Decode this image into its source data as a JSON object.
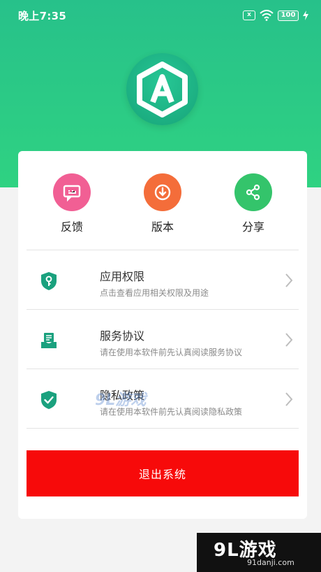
{
  "status_bar": {
    "time": "晚上7:35",
    "sim": "x",
    "battery": "100"
  },
  "quick_actions": [
    {
      "label": "反馈",
      "color": "#f15f94",
      "icon": "feedback-icon"
    },
    {
      "label": "版本",
      "color": "#f46d3a",
      "icon": "download-icon"
    },
    {
      "label": "分享",
      "color": "#34c46b",
      "icon": "share-icon"
    }
  ],
  "menu": [
    {
      "title": "应用权限",
      "subtitle": "点击查看应用相关权限及用途",
      "icon": "key-shield-icon"
    },
    {
      "title": "服务协议",
      "subtitle": "请在使用本软件前先认真阅读服务协议",
      "icon": "document-tray-icon"
    },
    {
      "title": "隐私政策",
      "subtitle": "请在使用本软件前先认真阅读隐私政策",
      "icon": "check-shield-icon"
    }
  ],
  "logout_label": "退出系统",
  "watermark": {
    "main": "9L游戏",
    "sub": "91danji.com",
    "faint": "9L游戏"
  },
  "colors": {
    "primary": "#27c18a",
    "danger": "#f70a0a",
    "icon_teal": "#1aa17e"
  }
}
